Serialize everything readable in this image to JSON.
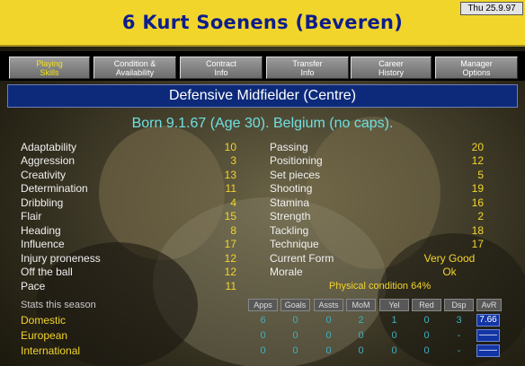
{
  "title": "6 Kurt Soenens (Beveren)",
  "date": "Thu 25.9.97",
  "tabs": [
    {
      "line1": "Playing",
      "line2": "Skills"
    },
    {
      "line1": "Condition &",
      "line2": "Availability"
    },
    {
      "line1": "Contract",
      "line2": "Info"
    },
    {
      "line1": "Transfer",
      "line2": "Info"
    },
    {
      "line1": "Career",
      "line2": "History"
    },
    {
      "line1": "Manager",
      "line2": "Options"
    }
  ],
  "position": "Defensive Midfielder (Centre)",
  "born": "Born 9.1.67 (Age 30). Belgium (no caps).",
  "attributes_left": [
    {
      "label": "Adaptability",
      "value": "10"
    },
    {
      "label": "Aggression",
      "value": "3"
    },
    {
      "label": "Creativity",
      "value": "13"
    },
    {
      "label": "Determination",
      "value": "11"
    },
    {
      "label": "Dribbling",
      "value": "4"
    },
    {
      "label": "Flair",
      "value": "15"
    },
    {
      "label": "Heading",
      "value": "8"
    },
    {
      "label": "Influence",
      "value": "17"
    },
    {
      "label": "Injury proneness",
      "value": "12"
    },
    {
      "label": "Off the ball",
      "value": "12"
    },
    {
      "label": "Pace",
      "value": "11"
    }
  ],
  "attributes_right": [
    {
      "label": "Passing",
      "value": "20"
    },
    {
      "label": "Positioning",
      "value": "12"
    },
    {
      "label": "Set pieces",
      "value": "5"
    },
    {
      "label": "Shooting",
      "value": "19"
    },
    {
      "label": "Stamina",
      "value": "16"
    },
    {
      "label": "Strength",
      "value": "2"
    },
    {
      "label": "Tackling",
      "value": "18"
    },
    {
      "label": "Technique",
      "value": "17"
    },
    {
      "label": "Current Form",
      "value": "Very Good"
    },
    {
      "label": "Morale",
      "value": "Ok"
    }
  ],
  "physical_condition": "Physical condition 64%",
  "stats": {
    "title": "Stats this season",
    "headers": [
      "Apps",
      "Goals",
      "Assts",
      "MoM",
      "Yel",
      "Red",
      "Dsp",
      "AvR"
    ],
    "rows": [
      {
        "label": "Domestic",
        "values": [
          "6",
          "0",
          "0",
          "2",
          "1",
          "0",
          "3"
        ],
        "avr": "7.66"
      },
      {
        "label": "European",
        "values": [
          "0",
          "0",
          "0",
          "0",
          "0",
          "0",
          "-"
        ],
        "avr": "——"
      },
      {
        "label": "International",
        "values": [
          "0",
          "0",
          "0",
          "0",
          "0",
          "0",
          "-"
        ],
        "avr": "——"
      }
    ]
  },
  "colors": {
    "title_bg": "#f2d52b",
    "title_text": "#0d1d8c",
    "value_yellow": "#f2d52b",
    "stat_cyan": "#3fb0c0",
    "born_cyan": "#6fe0e0"
  }
}
